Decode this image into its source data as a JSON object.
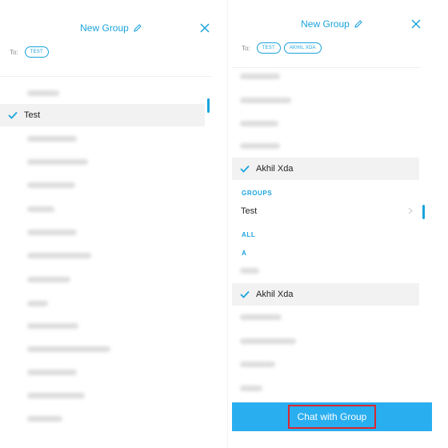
{
  "left_panel": {
    "title": "New Group",
    "to_label": "To:",
    "chips": [
      "TEST"
    ],
    "selected_item": "Test"
  },
  "right_panel": {
    "title": "New Group",
    "to_label": "To:",
    "chips": [
      "TEST",
      "AKHIL XDA"
    ],
    "selected_item_1": "Akhil Xda",
    "groups_label": "GROUPS",
    "group_item": "Test",
    "all_label": "ALL",
    "letter_a": "A",
    "selected_item_2": "Akhil Xda",
    "cta_label": "Chat with Group"
  },
  "colors": {
    "accent": "#1aa3dc",
    "cta_background": "#29aef0",
    "highlight_border": "#d9282f",
    "selected_row": "#f2f2f2"
  },
  "icons": [
    "pencil-icon",
    "close-icon",
    "check-icon",
    "chevron-right-icon"
  ]
}
